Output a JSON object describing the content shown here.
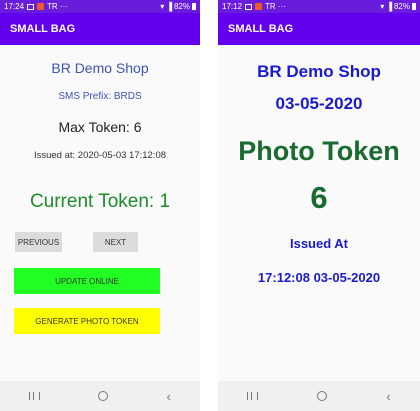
{
  "left_phone": {
    "status": {
      "time": "17:24",
      "extra": "TR ···",
      "battery": "82%"
    },
    "app_title": "SMALL BAG",
    "shop_name": "BR Demo Shop",
    "sms_prefix": "SMS Prefix: BRDS",
    "max_token": "Max Token: 6",
    "issued_at": "Issued at: 2020-05-03 17:12:08",
    "current_token": "Current Token: 1",
    "previous_label": "PREVIOUS",
    "next_label": "NEXT",
    "update_label": "UPDATE ONLINE",
    "generate_label": "GENERATE PHOTO TOKEN"
  },
  "right_phone": {
    "status": {
      "time": "17:12",
      "extra": "TR ···",
      "battery": "82%"
    },
    "app_title": "SMALL BAG",
    "shop_name": "BR Demo Shop",
    "date": "03-05-2020",
    "photo_token": "Photo Token",
    "token_number": "6",
    "issued_label": "Issued At",
    "issued_value": "17:12:08 03-05-2020"
  },
  "colors": {
    "status_bar": "#6a1cdc",
    "app_bar": "#6200ee",
    "shop_text": "#3a55b4",
    "token_green": "#1c8c2c",
    "blue_text": "#1a1ad0",
    "dark_green": "#196b30",
    "update_button": "#22ff22",
    "generate_button": "#ffff00",
    "nav_button": "#dcdcdc"
  },
  "nav_icons": [
    "recent-apps-icon",
    "home-icon",
    "back-icon"
  ]
}
